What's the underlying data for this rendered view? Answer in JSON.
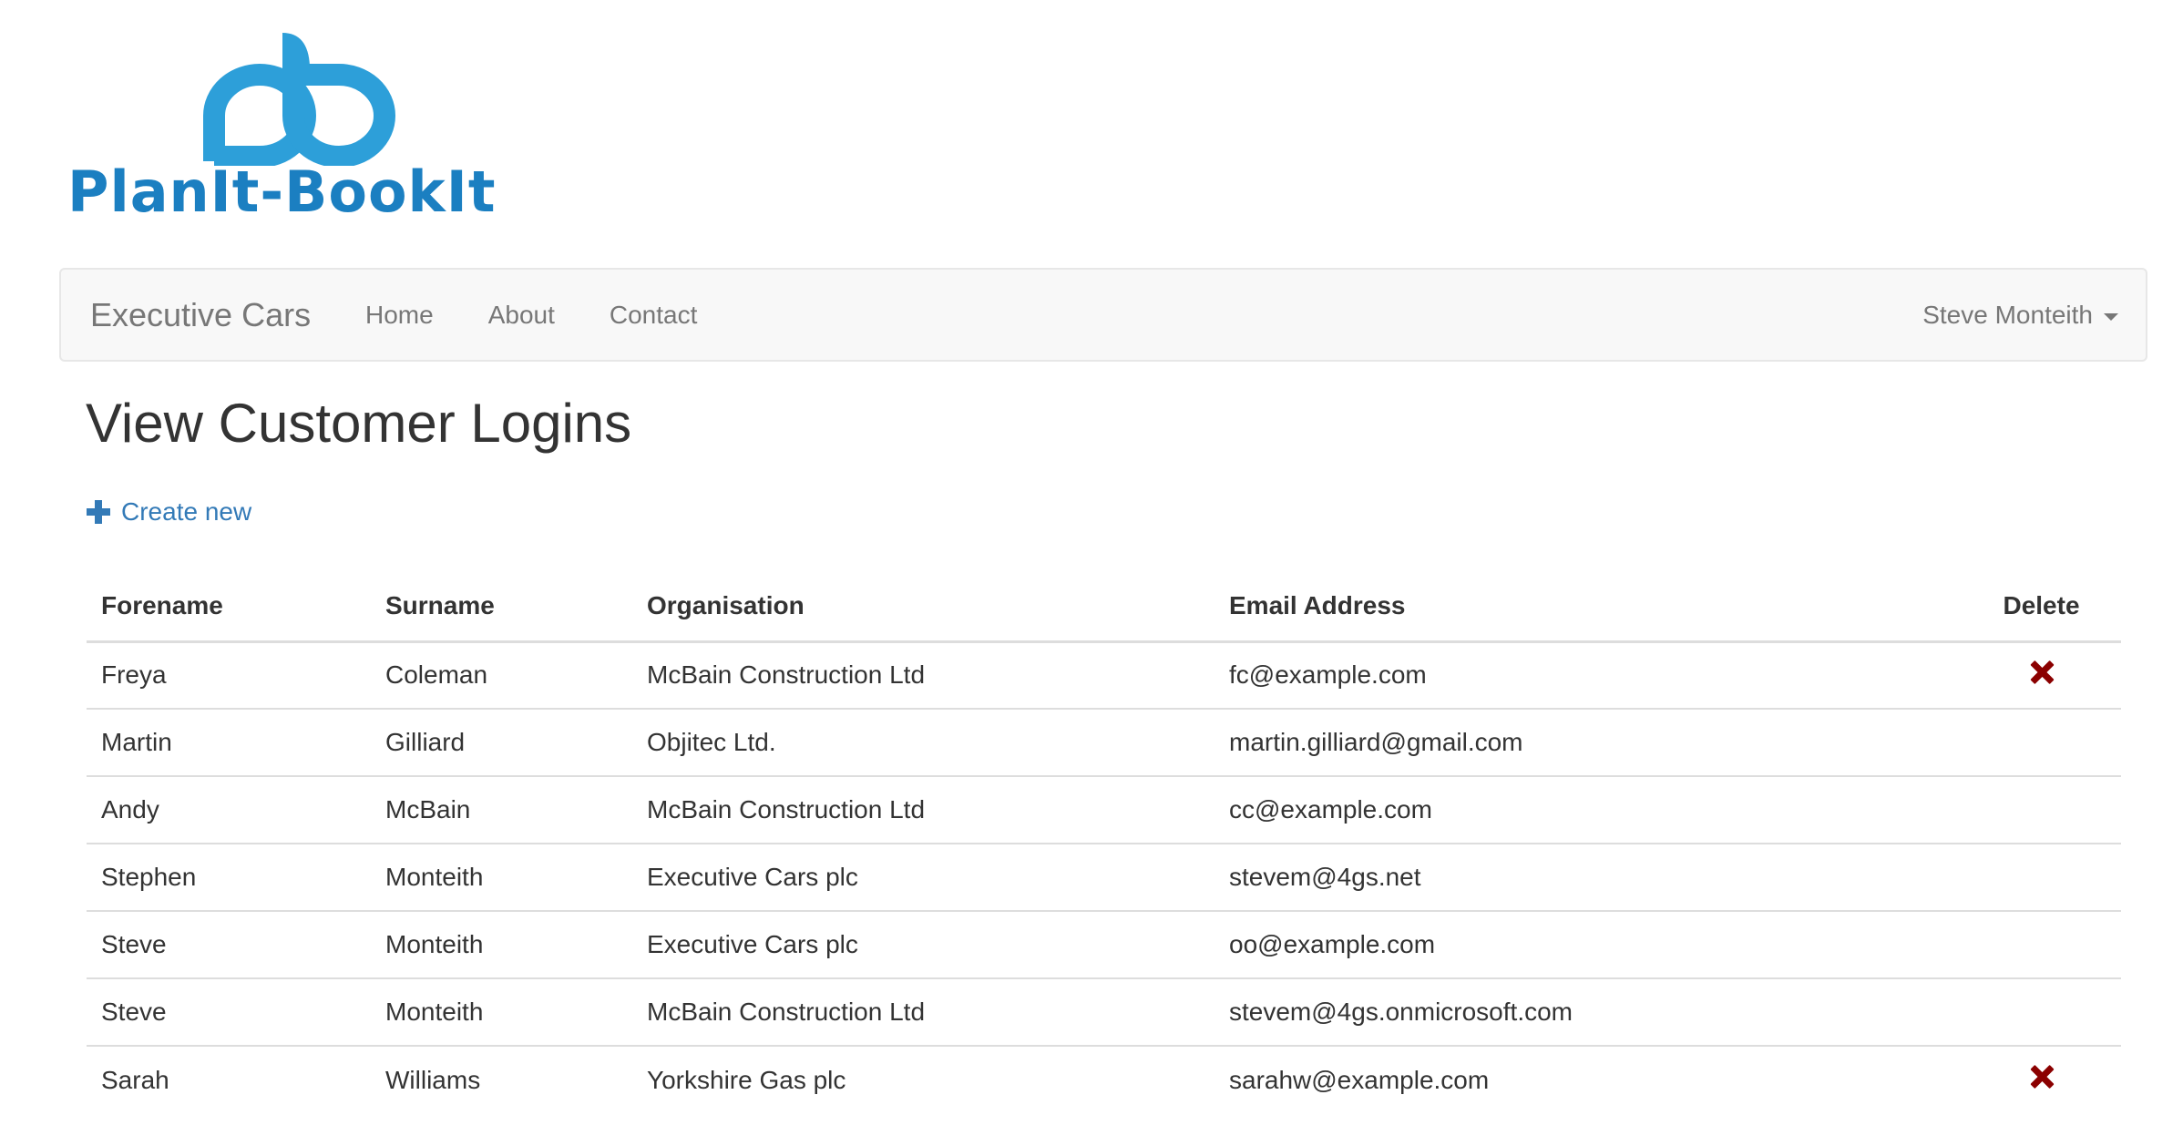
{
  "logo": {
    "text": "PlanIt-BookIt",
    "color": "#2d9fd9"
  },
  "navbar": {
    "brand": "Executive Cars",
    "links": [
      "Home",
      "About",
      "Contact"
    ],
    "user": "Steve Monteith",
    "user_menu_icon": "caret-down-icon"
  },
  "page": {
    "title": "View Customer Logins",
    "create_new": "Create new",
    "create_icon": "plus-icon"
  },
  "table": {
    "headers": [
      "Forename",
      "Surname",
      "Organisation",
      "Email Address",
      "Delete"
    ],
    "rows": [
      {
        "forename": "Freya",
        "surname": "Coleman",
        "organisation": "McBain Construction Ltd",
        "email": "fc@example.com",
        "deletable": true
      },
      {
        "forename": "Martin",
        "surname": "Gilliard",
        "organisation": "Objitec Ltd.",
        "email": "martin.gilliard@gmail.com",
        "deletable": false
      },
      {
        "forename": "Andy",
        "surname": "McBain",
        "organisation": "McBain Construction Ltd",
        "email": "cc@example.com",
        "deletable": false
      },
      {
        "forename": "Stephen",
        "surname": "Monteith",
        "organisation": "Executive Cars plc",
        "email": "stevem@4gs.net",
        "deletable": false
      },
      {
        "forename": "Steve",
        "surname": "Monteith",
        "organisation": "Executive Cars plc",
        "email": "oo@example.com",
        "deletable": false
      },
      {
        "forename": "Steve",
        "surname": "Monteith",
        "organisation": "McBain Construction Ltd",
        "email": "stevem@4gs.onmicrosoft.com",
        "deletable": false
      },
      {
        "forename": "Sarah",
        "surname": "Williams",
        "organisation": "Yorkshire Gas plc",
        "email": "sarahw@example.com",
        "deletable": true
      }
    ],
    "delete_icon": "delete-x-icon",
    "delete_color": "#8b0000"
  },
  "colors": {
    "link": "#337ab7",
    "navbar_bg": "#f8f8f8",
    "nav_text": "#777777"
  }
}
